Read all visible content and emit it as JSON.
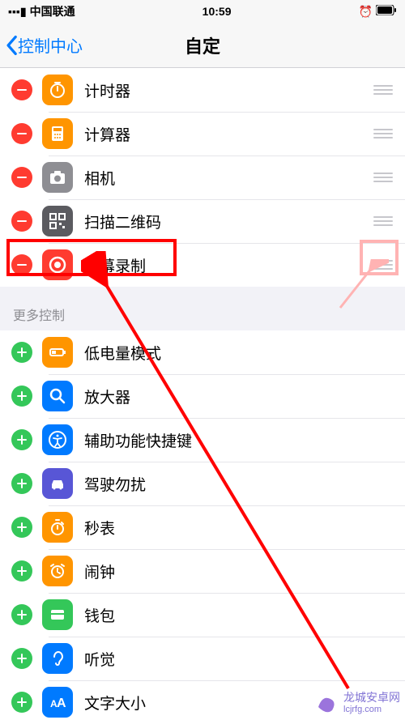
{
  "status": {
    "carrier": "中国联通",
    "time": "10:59"
  },
  "nav": {
    "back": "控制中心",
    "title": "自定"
  },
  "included": [
    {
      "id": "timer",
      "label": "计时器",
      "icon": "timer",
      "bg": "bg-orange"
    },
    {
      "id": "calculator",
      "label": "计算器",
      "icon": "calculator",
      "bg": "bg-orange"
    },
    {
      "id": "camera",
      "label": "相机",
      "icon": "camera",
      "bg": "bg-gray"
    },
    {
      "id": "qr",
      "label": "扫描二维码",
      "icon": "qr",
      "bg": "bg-darkgray"
    },
    {
      "id": "screenrec",
      "label": "屏幕录制",
      "icon": "record",
      "bg": "bg-red"
    }
  ],
  "more_header": "更多控制",
  "more": [
    {
      "id": "lowpower",
      "label": "低电量模式",
      "icon": "battery",
      "bg": "bg-orange"
    },
    {
      "id": "magnifier",
      "label": "放大器",
      "icon": "magnifier",
      "bg": "bg-blue"
    },
    {
      "id": "accessibility",
      "label": "辅助功能快捷键",
      "icon": "accessibility",
      "bg": "bg-blue"
    },
    {
      "id": "dnd-drive",
      "label": "驾驶勿扰",
      "icon": "car",
      "bg": "bg-purple"
    },
    {
      "id": "stopwatch",
      "label": "秒表",
      "icon": "stopwatch",
      "bg": "bg-orange"
    },
    {
      "id": "alarm",
      "label": "闹钟",
      "icon": "alarm",
      "bg": "bg-orange"
    },
    {
      "id": "wallet",
      "label": "钱包",
      "icon": "wallet",
      "bg": "bg-green"
    },
    {
      "id": "hearing",
      "label": "听觉",
      "icon": "ear",
      "bg": "bg-blue"
    },
    {
      "id": "textsize",
      "label": "文字大小",
      "icon": "textsize",
      "bg": "bg-blue"
    }
  ],
  "watermark": {
    "line1": "龙城安卓网",
    "line2": "lcjrfg.com"
  }
}
